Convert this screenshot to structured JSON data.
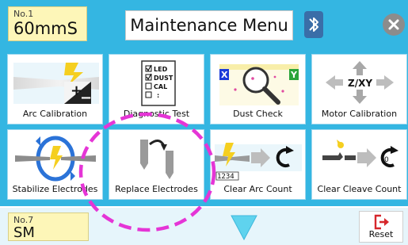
{
  "header": {
    "program_top": {
      "number": "No.1",
      "name": "60mmS"
    },
    "title": "Maintenance Menu",
    "bluetooth_icon": "bluetooth-icon",
    "close_icon": "close-icon"
  },
  "menu": [
    {
      "label": "Arc Calibration",
      "icon": "arc-calibration-icon"
    },
    {
      "label": "Diagnostic Test",
      "icon": "diagnostic-test-icon",
      "checklist": [
        "LED",
        "DUST",
        "CAL",
        ":"
      ]
    },
    {
      "label": "Dust Check",
      "icon": "dust-check-icon",
      "tags": [
        "X",
        "Y"
      ]
    },
    {
      "label": "Motor Calibration",
      "icon": "motor-calibration-icon",
      "axes": "Z/XY"
    },
    {
      "label": "Stabilize Electrodes",
      "icon": "stabilize-electrodes-icon"
    },
    {
      "label": "Replace Electrodes",
      "icon": "replace-electrodes-icon"
    },
    {
      "label": "Clear Arc Count",
      "icon": "clear-arc-count-icon",
      "counter": "1234"
    },
    {
      "label": "Clear Cleave Count",
      "icon": "clear-cleave-count-icon"
    }
  ],
  "footer": {
    "program_bottom": {
      "number": "No.7",
      "name": "SM"
    },
    "down_icon": "down-arrow-icon",
    "reset_label": "Reset",
    "reset_icon": "reset-icon"
  },
  "colors": {
    "header_bg": "#34b6e2",
    "program_bg": "#fdf6b8",
    "footer_bg": "#e6f5fb",
    "highlight": "#e535d6",
    "down_arrow": "#5fd3ee",
    "reset_red": "#d6262b"
  }
}
